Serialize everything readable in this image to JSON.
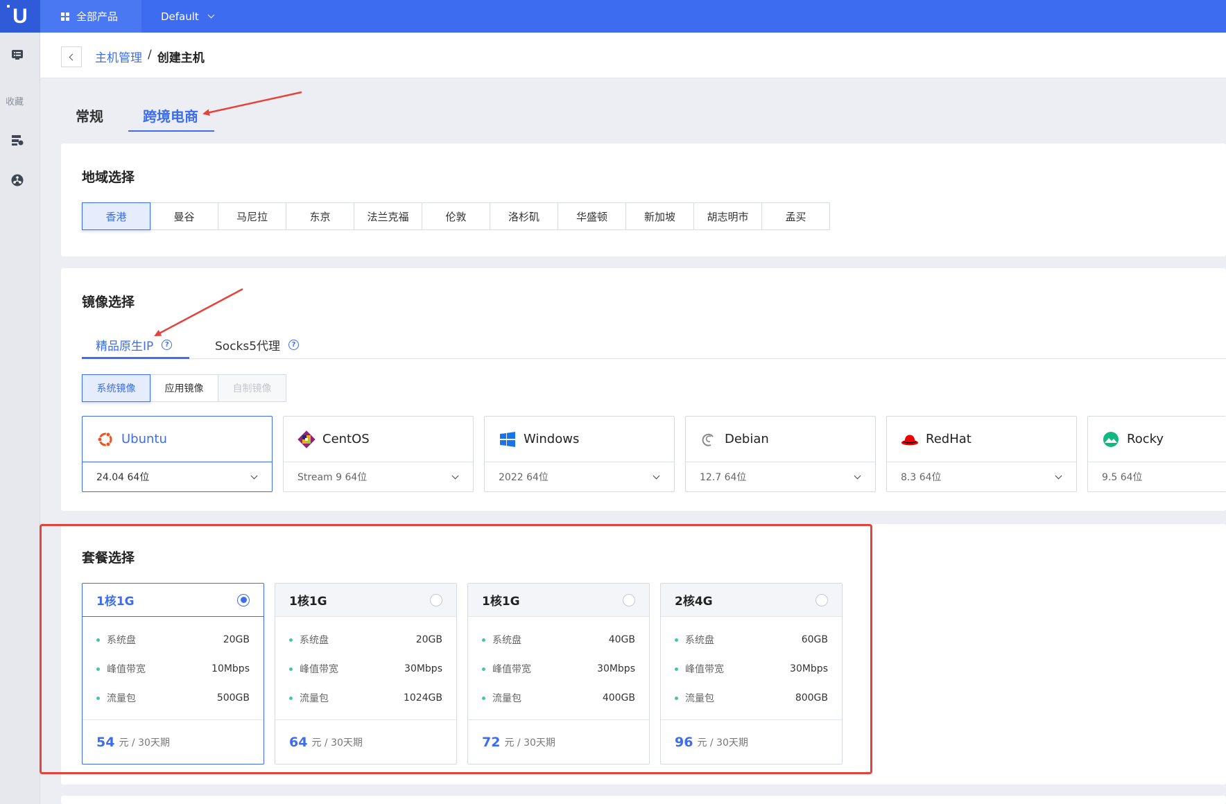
{
  "topbar": {
    "logo": "U",
    "all_products": "全部产品",
    "project": "Default"
  },
  "sidebar": {
    "favorites": "收藏"
  },
  "breadcrumb": {
    "parent": "主机管理",
    "separator": "/",
    "current": "创建主机"
  },
  "main_tabs": [
    {
      "label": "常规"
    },
    {
      "label": "跨境电商"
    }
  ],
  "region": {
    "title": "地域选择",
    "options": [
      "香港",
      "曼谷",
      "马尼拉",
      "东京",
      "法兰克福",
      "伦敦",
      "洛杉矶",
      "华盛顿",
      "新加坡",
      "胡志明市",
      "孟买"
    ],
    "selected": "香港"
  },
  "image": {
    "title": "镜像选择",
    "tabs": [
      {
        "label": "精品原生IP"
      },
      {
        "label": "Socks5代理"
      }
    ],
    "types": [
      "系统镜像",
      "应用镜像",
      "自制镜像"
    ],
    "os": [
      {
        "name": "Ubuntu",
        "version": "24.04 64位",
        "icon": "ubuntu-icon"
      },
      {
        "name": "CentOS",
        "version": "Stream 9 64位",
        "icon": "centos-icon"
      },
      {
        "name": "Windows",
        "version": "2022 64位",
        "icon": "windows-icon"
      },
      {
        "name": "Debian",
        "version": "12.7 64位",
        "icon": "debian-icon"
      },
      {
        "name": "RedHat",
        "version": "8.3 64位",
        "icon": "redhat-icon"
      },
      {
        "name": "Rocky",
        "version": "9.5 64位",
        "icon": "rocky-icon"
      }
    ]
  },
  "package": {
    "title": "套餐选择",
    "labels": {
      "disk": "系统盘",
      "bandwidth": "峰值带宽",
      "traffic": "流量包"
    },
    "unit": "元",
    "period": "/ 30天期",
    "plans": [
      {
        "name": "1核1G",
        "disk": "20GB",
        "bandwidth": "10Mbps",
        "traffic": "500GB",
        "price": "54"
      },
      {
        "name": "1核1G",
        "disk": "20GB",
        "bandwidth": "30Mbps",
        "traffic": "1024GB",
        "price": "64"
      },
      {
        "name": "1核1G",
        "disk": "40GB",
        "bandwidth": "30Mbps",
        "traffic": "400GB",
        "price": "72"
      },
      {
        "name": "2核4G",
        "disk": "60GB",
        "bandwidth": "30Mbps",
        "traffic": "800GB",
        "price": "96"
      }
    ]
  },
  "colors": {
    "primary": "#3d6cf0",
    "annotation": "#e5433a",
    "dot": "#3ec8b0"
  }
}
